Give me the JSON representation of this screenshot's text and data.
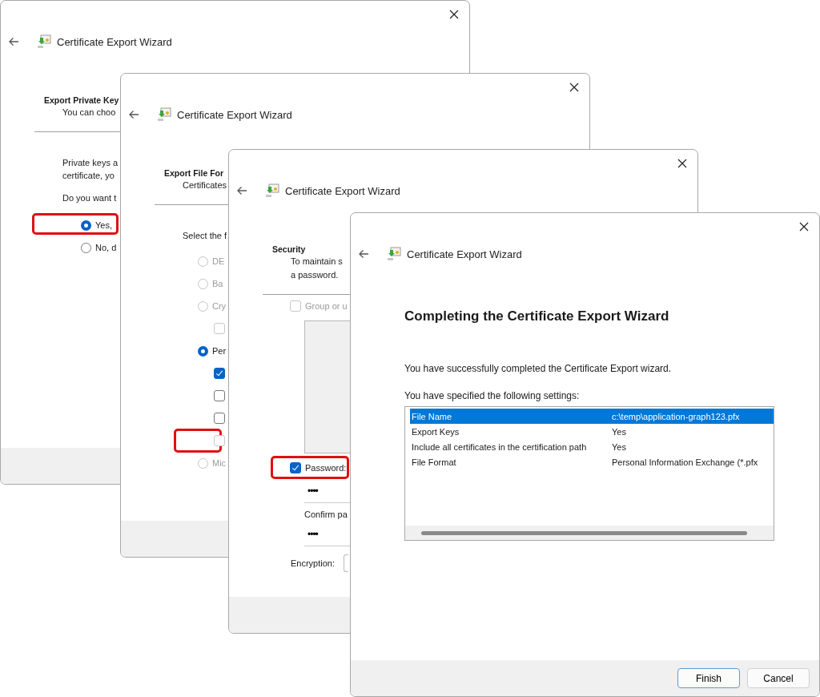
{
  "windows": [
    {
      "kind": "private-key",
      "title": "Certificate Export Wizard",
      "heading": "Export Private Key",
      "subheading": [
        "You can choo"
      ],
      "paragraphs": [
        [
          "Private keys a",
          "certificate, yo"
        ],
        [
          "Do you want t"
        ]
      ],
      "options": [
        {
          "kind": "radio",
          "label": "Yes,",
          "selected": true,
          "disabled": false,
          "highlighted": true
        },
        {
          "kind": "radio",
          "label": "No, d",
          "selected": false,
          "disabled": false,
          "highlighted": false
        }
      ]
    },
    {
      "kind": "file-format",
      "title": "Certificate Export Wizard",
      "heading": "Export File For",
      "subheading": [
        "Certificates"
      ],
      "paragraphs": [
        [
          "Select the f"
        ]
      ],
      "options": [
        {
          "kind": "radio",
          "label": "DE",
          "selected": false,
          "disabled": true,
          "highlighted": false
        },
        {
          "kind": "radio",
          "label": "Ba",
          "selected": false,
          "disabled": true,
          "highlighted": false
        },
        {
          "kind": "radio",
          "label": "Cry",
          "selected": false,
          "disabled": true,
          "highlighted": false,
          "children": [
            {
              "kind": "checkbox",
              "checked": false,
              "disabled": true,
              "highlighted": false
            }
          ]
        },
        {
          "kind": "radio",
          "label": "Per",
          "selected": true,
          "disabled": false,
          "highlighted": false,
          "children": [
            {
              "kind": "checkbox",
              "checked": true,
              "disabled": false,
              "highlighted": false
            },
            {
              "kind": "checkbox",
              "checked": false,
              "disabled": false,
              "highlighted": false
            },
            {
              "kind": "checkbox",
              "checked": false,
              "disabled": false,
              "highlighted": false
            },
            {
              "kind": "checkbox",
              "checked": false,
              "disabled": true,
              "highlighted": true
            }
          ]
        },
        {
          "kind": "radio",
          "label": "Mic",
          "selected": false,
          "disabled": true,
          "highlighted": false
        }
      ]
    },
    {
      "kind": "security",
      "title": "Certificate Export Wizard",
      "heading": "Security",
      "subheading": [
        "To maintain s",
        "a password."
      ],
      "group_option": {
        "label": "Group or u",
        "checked": false,
        "disabled": true
      },
      "password_option": {
        "label": "Password:",
        "checked": true,
        "disabled": false,
        "highlighted": true
      },
      "password": {
        "value": "••••"
      },
      "confirm_label": "Confirm pa",
      "confirm": {
        "value": "••••"
      },
      "encryption_label": "Encryption:"
    },
    {
      "kind": "completion",
      "title": "Certificate Export Wizard",
      "heading": "Completing the Certificate Export Wizard",
      "paragraphs": [
        [
          "You have successfully completed the Certificate Export wizard."
        ],
        [
          "You have specified the following settings:"
        ]
      ],
      "settings": [
        {
          "name": "File Name",
          "value": "c:\\temp\\application-graph123.pfx",
          "selected": true
        },
        {
          "name": "Export Keys",
          "value": "Yes",
          "selected": false
        },
        {
          "name": "Include all certificates in the certification path",
          "value": "Yes",
          "selected": false
        },
        {
          "name": "File Format",
          "value": "Personal Information Exchange (*.pfx",
          "selected": false
        }
      ],
      "buttons": [
        {
          "label": "Finish",
          "default": true
        },
        {
          "label": "Cancel",
          "default": false
        }
      ]
    }
  ]
}
